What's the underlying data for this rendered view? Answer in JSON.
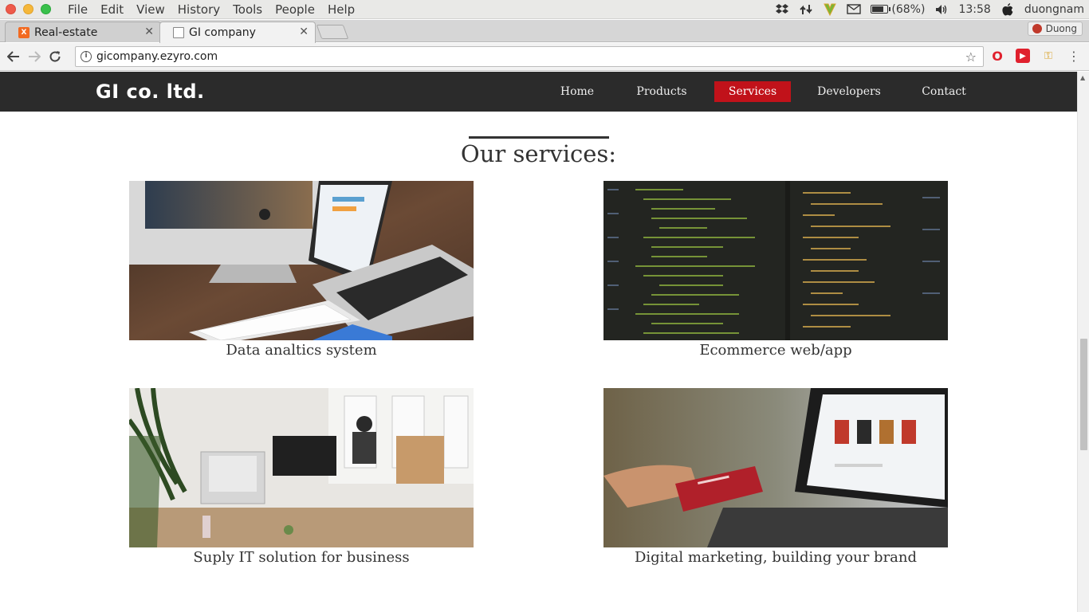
{
  "os_bar": {
    "menu": [
      "File",
      "Edit",
      "View",
      "History",
      "Tools",
      "People",
      "Help"
    ],
    "battery": "(68%)",
    "battery_level": 0.68,
    "time": "13:58",
    "user": "duongnam",
    "tray_icons": [
      "dropbox-icon",
      "network-icon",
      "vpn-icon",
      "mail-icon",
      "battery-icon",
      "volume-icon",
      "apple-icon"
    ]
  },
  "tabs": [
    {
      "title": "Real-estate",
      "favicon": "xampp-icon",
      "active": false
    },
    {
      "title": "GI company",
      "favicon": "page-icon",
      "active": true
    }
  ],
  "profile_name": "Duong",
  "address": {
    "url": "gicompany.ezyro.com"
  },
  "site": {
    "logo": "GI co. ltd.",
    "nav": [
      "Home",
      "Products",
      "Services",
      "Developers",
      "Contact"
    ],
    "active_nav": "Services",
    "accent_color": "#c1121a",
    "nav_bg": "#2b2b2b"
  },
  "section": {
    "title": "Our services:"
  },
  "services": [
    {
      "caption": "Data analtics system",
      "image": "imac-laptop-keyboard-photo"
    },
    {
      "caption": "Ecommerce web/app",
      "image": "code-editor-screen-photo"
    },
    {
      "caption": "Suply IT solution for business",
      "image": "office-workspace-photo"
    },
    {
      "caption": "Digital marketing, building your brand",
      "image": "credit-card-laptop-photo"
    }
  ]
}
